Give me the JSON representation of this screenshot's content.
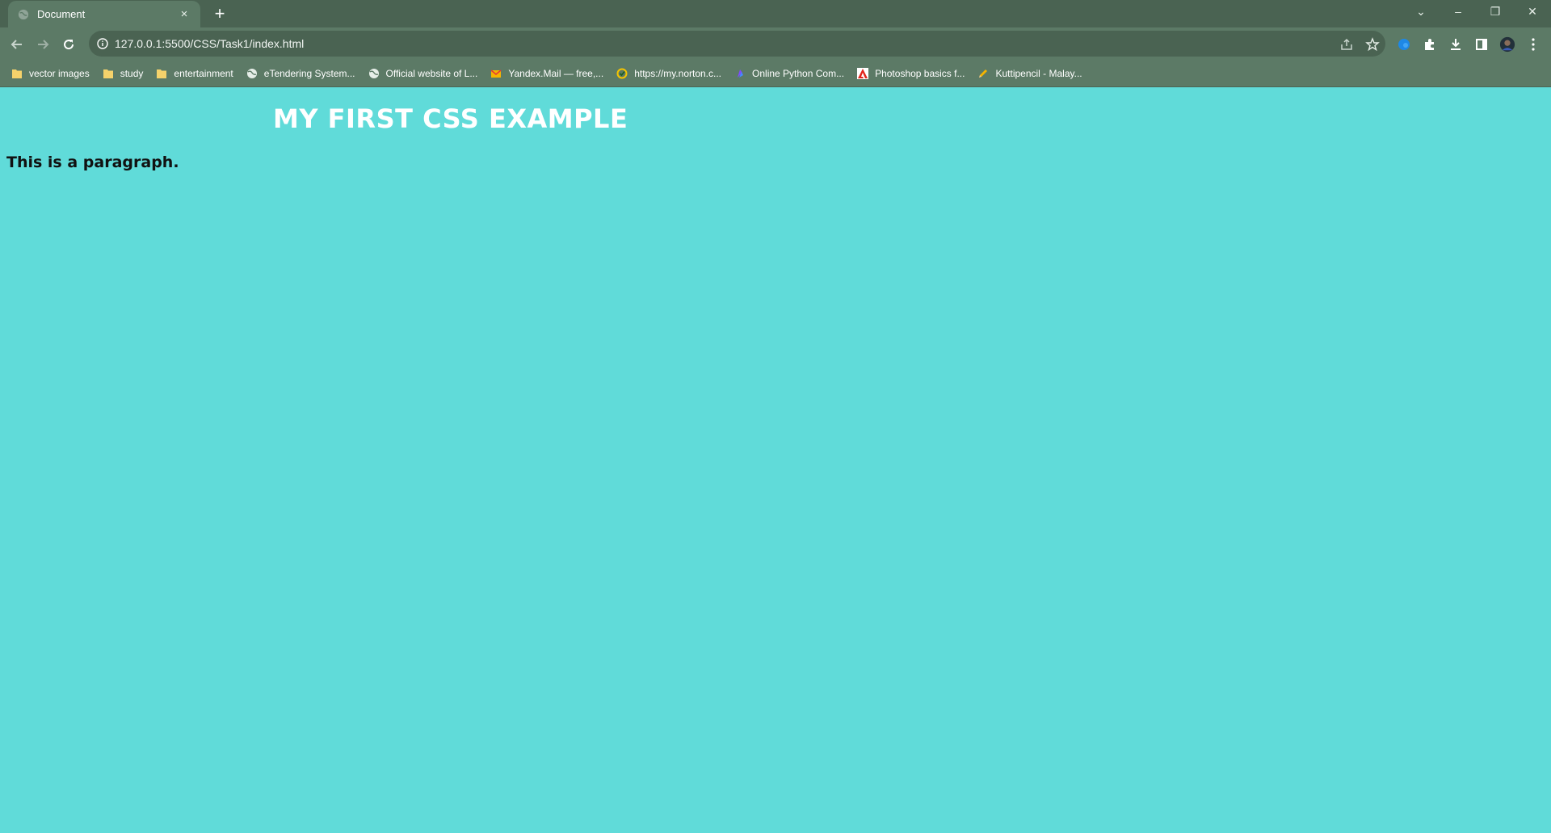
{
  "browser": {
    "tab": {
      "title": "Document",
      "close_glyph": "×",
      "icon": "globe-icon"
    },
    "new_tab_glyph": "+",
    "window_controls": {
      "list_tabs": "⌄",
      "minimize": "–",
      "restore": "❐",
      "close": "✕"
    },
    "address_bar": {
      "url": "127.0.0.1:5500/CSS/Task1/index.html"
    },
    "bookmarks": [
      {
        "label": "vector images",
        "icon": "folder-icon"
      },
      {
        "label": "study",
        "icon": "folder-icon"
      },
      {
        "label": "entertainment",
        "icon": "folder-icon"
      },
      {
        "label": "eTendering System...",
        "icon": "globe-icon"
      },
      {
        "label": "Official website of L...",
        "icon": "globe-icon"
      },
      {
        "label": "Yandex.Mail — free,...",
        "icon": "mail-icon"
      },
      {
        "label": "https://my.norton.c...",
        "icon": "norton-icon"
      },
      {
        "label": "Online Python Com...",
        "icon": "python-icon"
      },
      {
        "label": "Photoshop basics f...",
        "icon": "adobe-icon"
      },
      {
        "label": "Kuttipencil - Malay...",
        "icon": "pencil-icon"
      }
    ]
  },
  "page": {
    "heading": "MY FIRST CSS EXAMPLE",
    "paragraph": "This is a paragraph.",
    "background_color": "#60dbd9"
  },
  "colors": {
    "tab_strip": "#4a6352",
    "toolbar": "#5c7a66",
    "folder": "#f5d26b"
  }
}
